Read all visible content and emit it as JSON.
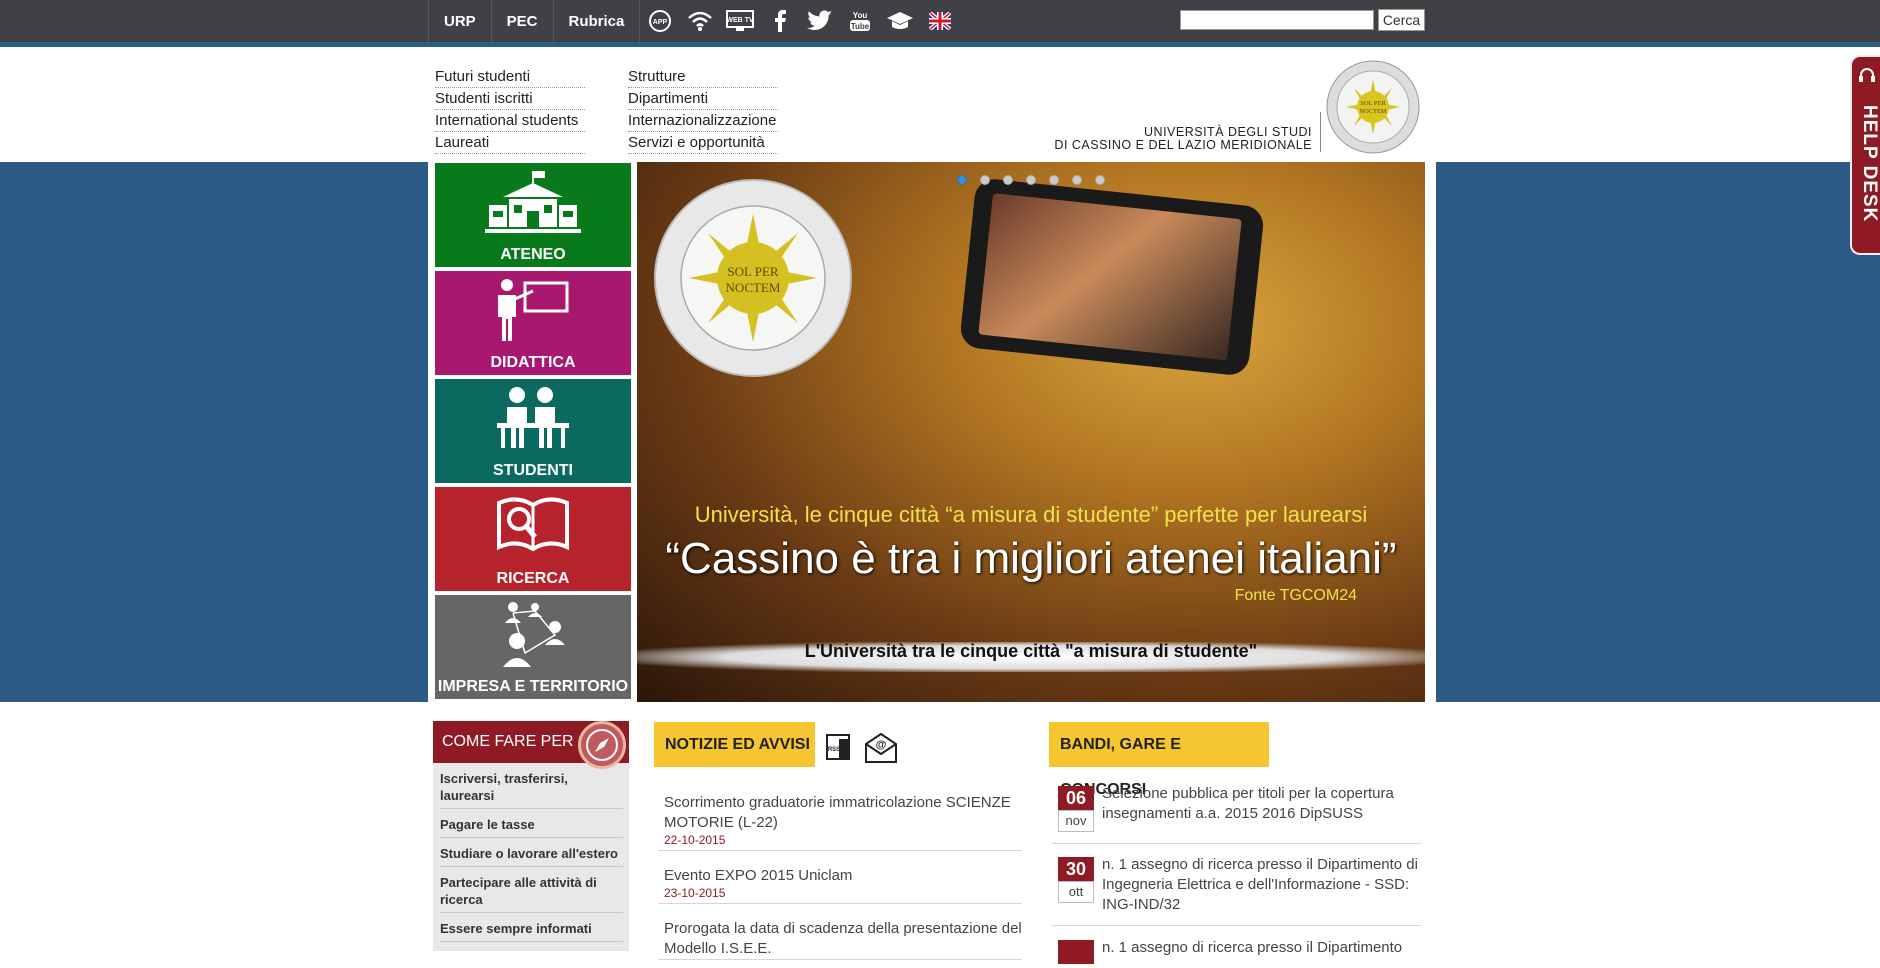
{
  "topbar": {
    "links": [
      "URP",
      "PEC",
      "Rubrica"
    ],
    "icons": [
      "app-icon",
      "wifi-icon",
      "webtv-icon",
      "facebook-icon",
      "twitter-icon",
      "youtube-icon",
      "graduation-cap-icon",
      "uk-flag-icon"
    ],
    "search_placeholder": "",
    "search_button": "Cerca"
  },
  "header": {
    "nav_col1": [
      "Futuri studenti",
      "Studenti iscritti",
      "International students",
      "Laureati"
    ],
    "nav_col2": [
      "Strutture",
      "Dipartimenti",
      "Internazionalizzazione",
      "Servizi e opportunità"
    ],
    "university_line1": "UNIVERSITÀ DEGLI STUDI",
    "university_line2": "DI CASSINO E DEL LAZIO MERIDIONALE",
    "logo_text": "SOL PER NOCTEM"
  },
  "tiles": [
    {
      "label": "ATENEO",
      "color": "#097a1c"
    },
    {
      "label": "DIDATTICA",
      "color": "#a8186f"
    },
    {
      "label": "STUDENTI",
      "color": "#0a6a5f"
    },
    {
      "label": "RICERCA",
      "color": "#b7232d"
    },
    {
      "label": "IMPRESA E TERRITORIO",
      "color": "#666666"
    }
  ],
  "slider": {
    "dot_count": 7,
    "active_dot": 1,
    "seal_text": "SOL PER NOCTEM",
    "subtitle": "Università, le cinque città “a misura di studente” perfette per laurearsi",
    "title": "“Cassino è tra i migliori atenei italiani”",
    "source": "Fonte TGCOM24",
    "caption": "L'Università tra le cinque città \"a misura di studente\""
  },
  "helpdesk": {
    "label": "HELP DESK"
  },
  "come_fare_per": {
    "title": "COME FARE PER",
    "items": [
      "Iscriversi, trasferirsi, laurearsi",
      "Pagare le tasse",
      "Studiare o lavorare all'estero",
      "Partecipare alle attività di ricerca",
      "Essere sempre informati"
    ]
  },
  "news": {
    "title": "NOTIZIE ED AVVISI",
    "items": [
      {
        "title": "Scorrimento graduatorie immatricolazione SCIENZE MOTORIE (L-22)",
        "date": "22-10-2015"
      },
      {
        "title": "Evento EXPO 2015 Uniclam",
        "date": "23-10-2015"
      },
      {
        "title": "Prorogata la data di scadenza della presentazione del Modello I.S.E.E.",
        "date": ""
      }
    ]
  },
  "bandi": {
    "title": "BANDI, GARE E CONCORSI",
    "items": [
      {
        "day": "06",
        "month": "nov",
        "text": "Selezione pubblica per titoli per la copertura insegnamenti a.a. 2015 2016 DipSUSS"
      },
      {
        "day": "30",
        "month": "ott",
        "text": "n. 1 assegno di ricerca presso il Dipartimento di Ingegneria Elettrica e dell'Informazione - SSD: ING-IND/32"
      },
      {
        "day": "",
        "month": "",
        "text": "n. 1 assegno di ricerca presso il Dipartimento"
      }
    ]
  }
}
